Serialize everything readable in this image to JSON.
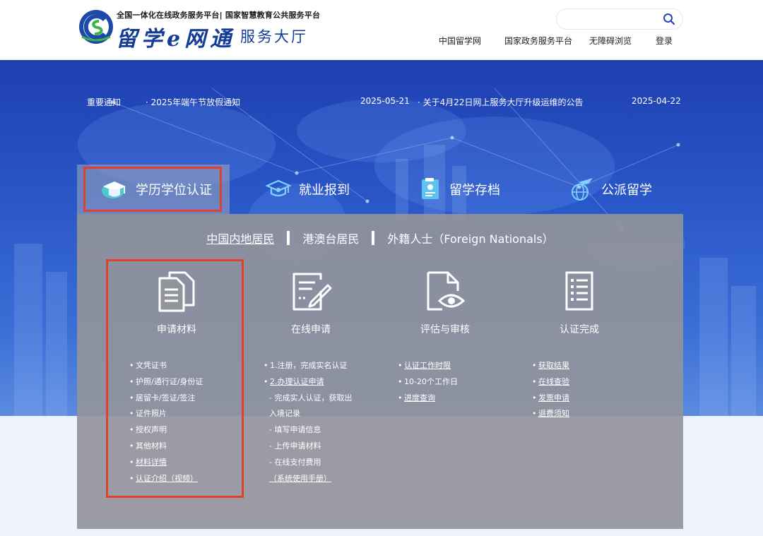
{
  "header": {
    "top_line": "全国一体化在线政务服务平台| 国家智慧教育公共服务平台",
    "main_title": "留学e网通",
    "sub_title": "服务大厅",
    "search_placeholder": "",
    "nav": [
      "中国留学网",
      "国家政务服务平台",
      "无障碍浏览",
      "登录"
    ]
  },
  "notices": {
    "label": "重要通知",
    "items": [
      {
        "title": "· 2025年端午节放假通知",
        "date": "2025-05-21"
      },
      {
        "title": "· 关于4月22日网上服务大厅升级运维的公告",
        "date": "2025-04-22"
      }
    ]
  },
  "tabs": [
    {
      "label": "学历学位认证",
      "icon": "graduation-cap-icon",
      "active": true
    },
    {
      "label": "就业报到",
      "icon": "mortarboard-icon",
      "active": false
    },
    {
      "label": "留学存档",
      "icon": "archive-icon",
      "active": false
    },
    {
      "label": "公派留学",
      "icon": "globe-plane-icon",
      "active": false
    }
  ],
  "resident_tabs": [
    "中国内地居民",
    "港澳台居民",
    "外籍人士（Foreign Nationals）"
  ],
  "steps": [
    {
      "title": "申请材料",
      "icon": "documents-icon",
      "items": [
        {
          "text": "文凭证书",
          "link": false,
          "bullet": true
        },
        {
          "text": "护照/通行证/身份证",
          "link": false,
          "bullet": true
        },
        {
          "text": "居留卡/签证/签注",
          "link": false,
          "bullet": true
        },
        {
          "text": "证件照片",
          "link": false,
          "bullet": true
        },
        {
          "text": "授权声明",
          "link": false,
          "bullet": true
        },
        {
          "text": "其他材料",
          "link": false,
          "bullet": true
        },
        {
          "text": "材料详情",
          "link": true,
          "bullet": true
        },
        {
          "text": "认证介绍（视频）",
          "link": true,
          "bullet": true
        }
      ]
    },
    {
      "title": "在线申请",
      "icon": "edit-form-icon",
      "items": [
        {
          "text": "1.注册，完成实名认证",
          "link": false,
          "bullet": true
        },
        {
          "text": "2.办理认证申请",
          "link": true,
          "bullet": true,
          "prefix": "2."
        },
        {
          "text": "- 完成实人认证，获取出",
          "link": false,
          "bullet": false
        },
        {
          "text": "入境记录",
          "link": false,
          "bullet": false
        },
        {
          "text": "- 填写申请信息",
          "link": false,
          "bullet": false
        },
        {
          "text": "- 上传申请材料",
          "link": false,
          "bullet": false
        },
        {
          "text": "- 在线支付费用",
          "link": false,
          "bullet": false
        },
        {
          "text": "（系统使用手册）",
          "link": true,
          "bullet": false
        }
      ]
    },
    {
      "title": "评估与审核",
      "icon": "document-eye-icon",
      "items": [
        {
          "text": "认证工作时限",
          "link": true,
          "bullet": true
        },
        {
          "text": "10-20个工作日",
          "link": false,
          "bullet": true
        },
        {
          "text": "进度查询",
          "link": true,
          "bullet": true
        }
      ]
    },
    {
      "title": "认证完成",
      "icon": "checklist-icon",
      "items": [
        {
          "text": "获取结果",
          "link": true,
          "bullet": true
        },
        {
          "text": "在线查验",
          "link": true,
          "bullet": true
        },
        {
          "text": "发票申请",
          "link": true,
          "bullet": true
        },
        {
          "text": "退费须知",
          "link": true,
          "bullet": true
        }
      ]
    }
  ],
  "colors": {
    "brand_blue": "#143c96",
    "highlight_red": "#e0412b",
    "panel_gray": "#92949c"
  }
}
